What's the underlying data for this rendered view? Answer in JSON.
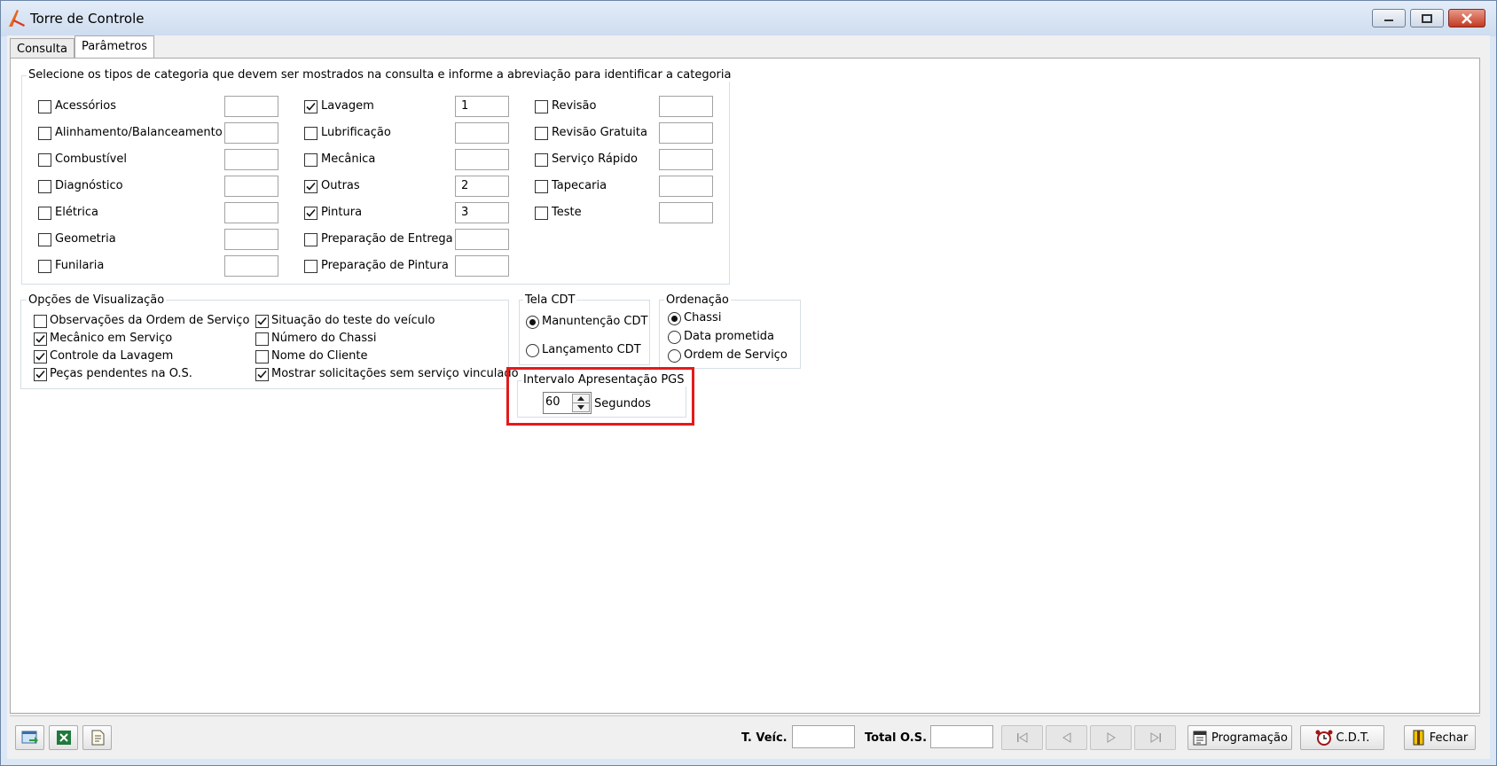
{
  "window": {
    "title": "Torre de Controle"
  },
  "tabs": [
    {
      "label": "Consulta"
    },
    {
      "label": "Parâmetros"
    }
  ],
  "categories": {
    "legend": "Selecione os tipos de categoria que devem ser mostrados na consulta e informe a abreviação para identificar a categoria",
    "col1": [
      {
        "label": "Acessórios",
        "checked": false,
        "abbr": ""
      },
      {
        "label": "Alinhamento/Balanceamento",
        "checked": false,
        "abbr": ""
      },
      {
        "label": "Combustível",
        "checked": false,
        "abbr": ""
      },
      {
        "label": "Diagnóstico",
        "checked": false,
        "abbr": ""
      },
      {
        "label": "Elétrica",
        "checked": false,
        "abbr": ""
      },
      {
        "label": "Geometria",
        "checked": false,
        "abbr": ""
      },
      {
        "label": "Funilaria",
        "checked": false,
        "abbr": ""
      }
    ],
    "col2": [
      {
        "label": "Lavagem",
        "checked": true,
        "abbr": "1"
      },
      {
        "label": "Lubrificação",
        "checked": false,
        "abbr": ""
      },
      {
        "label": "Mecânica",
        "checked": false,
        "abbr": ""
      },
      {
        "label": "Outras",
        "checked": true,
        "abbr": "2"
      },
      {
        "label": "Pintura",
        "checked": true,
        "abbr": "3"
      },
      {
        "label": "Preparação de Entrega",
        "checked": false,
        "abbr": ""
      },
      {
        "label": "Preparação de Pintura",
        "checked": false,
        "abbr": ""
      }
    ],
    "col3": [
      {
        "label": "Revisão",
        "checked": false,
        "abbr": ""
      },
      {
        "label": "Revisão Gratuita",
        "checked": false,
        "abbr": ""
      },
      {
        "label": "Serviço Rápido",
        "checked": false,
        "abbr": ""
      },
      {
        "label": "Tapecaria",
        "checked": false,
        "abbr": ""
      },
      {
        "label": "Teste",
        "checked": false,
        "abbr": ""
      }
    ]
  },
  "visualizacao": {
    "legend": "Opções de Visualização",
    "col1": [
      {
        "label": "Observações da Ordem de Serviço",
        "checked": false
      },
      {
        "label": "Mecânico em Serviço",
        "checked": true
      },
      {
        "label": "Controle da Lavagem",
        "checked": true
      },
      {
        "label": "Peças pendentes na O.S.",
        "checked": true
      }
    ],
    "col2": [
      {
        "label": "Situação do teste do veículo",
        "checked": true
      },
      {
        "label": "Número do Chassi",
        "checked": false
      },
      {
        "label": "Nome do Cliente",
        "checked": false
      },
      {
        "label": "Mostrar solicitações sem serviço vinculado",
        "checked": true
      }
    ]
  },
  "tela_cdt": {
    "legend": "Tela CDT",
    "options": [
      {
        "label": "Manuntenção CDT",
        "selected": true
      },
      {
        "label": "Lançamento CDT",
        "selected": false
      }
    ]
  },
  "ordenacao": {
    "legend": "Ordenação",
    "options": [
      {
        "label": "Chassi",
        "selected": true
      },
      {
        "label": "Data prometida",
        "selected": false
      },
      {
        "label": "Ordem de Serviço",
        "selected": false
      }
    ]
  },
  "intervalo": {
    "legend": "Intervalo Apresentação PGS",
    "value": "60",
    "unit": "Segundos"
  },
  "bottom": {
    "t_veic_label": "T. Veíc.",
    "t_veic_value": "",
    "total_os_label": "Total O.S.",
    "total_os_value": "",
    "programacao_label": "Programação",
    "cdt_label": "C.D.T.",
    "fechar_label": "Fechar"
  },
  "colors": {
    "highlight": "#e41a1a",
    "group_border": "#d5dfe5",
    "title_gradient_top": "#e4edf8"
  }
}
